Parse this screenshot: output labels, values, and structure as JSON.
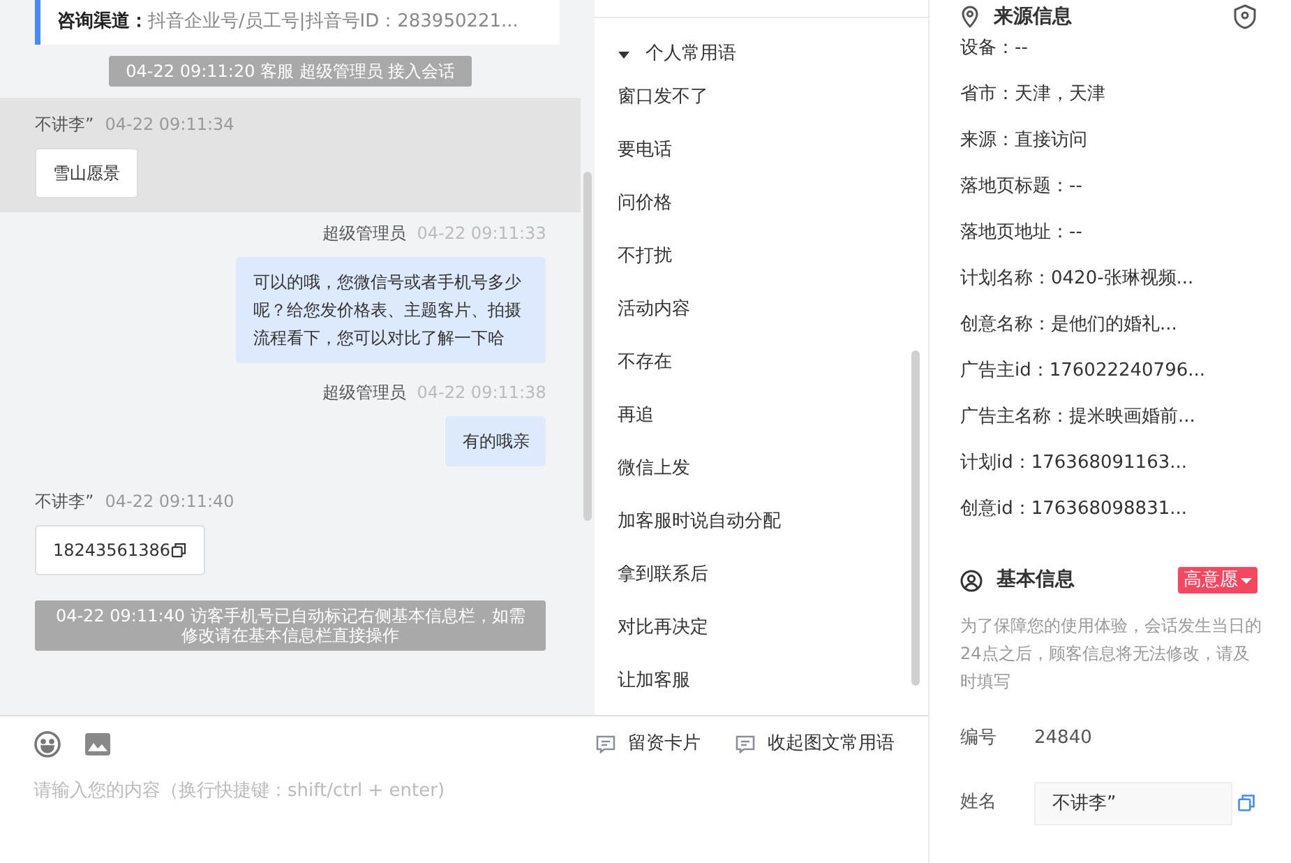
{
  "chat": {
    "channel_card": {
      "label": "咨询渠道：",
      "value": "抖音企业号/员工号|抖音号ID：283950221..."
    },
    "messages": [
      {
        "kind": "system",
        "text": "04-22 09:11:20 客服 超级管理员 接入会话"
      },
      {
        "kind": "visitor",
        "sender": "不讲李”",
        "time": "04-22 09:11:34",
        "text": "雪山愿景",
        "selected": true,
        "copyable": false
      },
      {
        "kind": "agent",
        "sender": "超级管理员",
        "time": "04-22 09:11:33",
        "text": "可以的哦，您微信号或者手机号多少呢？给您发价格表、主题客片、拍摄流程看下，您可以对比了解一下哈"
      },
      {
        "kind": "agent",
        "sender": "超级管理员",
        "time": "04-22 09:11:38",
        "text": "有的哦亲"
      },
      {
        "kind": "visitor",
        "sender": "不讲李”",
        "time": "04-22 09:11:40",
        "text": "18243561386",
        "selected": false,
        "copyable": true
      },
      {
        "kind": "system",
        "text": "04-22 09:11:40 访客手机号已自动标记右侧基本信息栏，如需修改请在基本信息栏直接操作"
      }
    ]
  },
  "quick_replies": {
    "group": {
      "label": "个人常用语",
      "expanded": true
    },
    "items": [
      "窗口发不了",
      "要电话",
      "问价格",
      "不打扰",
      "活动内容",
      "不存在",
      "再追",
      "微信上发",
      "加客服时说自动分配",
      "拿到联系后",
      "对比再决定",
      "让加客服"
    ]
  },
  "composer": {
    "placeholder": "请输入您的内容（换行快捷键：shift/ctrl + enter)",
    "actions": [
      "留资卡片",
      "收起图文常用语"
    ]
  },
  "source_info": {
    "title": "来源信息",
    "fields": [
      "设备：--",
      "省市：天津，天津",
      "来源：直接访问",
      "落地页标题：--",
      "落地页地址：--",
      "计划名称：0420-张琳视频...",
      "创意名称：是他们的婚礼...",
      "广告主id：176022240796...",
      "广告主名称：提米映画婚前...",
      "计划id：176368091163...",
      "创意id：176368098831..."
    ]
  },
  "basic_info": {
    "title": "基本信息",
    "tag": {
      "label": "高意愿",
      "color": "#f5475f"
    },
    "notice": "为了保障您的使用体验，会话发生当日的24点之后，顾客信息将无法修改，请及时填写",
    "fields": [
      {
        "kind": "text",
        "label": "编号",
        "value": "24840"
      },
      {
        "kind": "input",
        "label": "姓名",
        "value": "不讲李”"
      }
    ]
  }
}
